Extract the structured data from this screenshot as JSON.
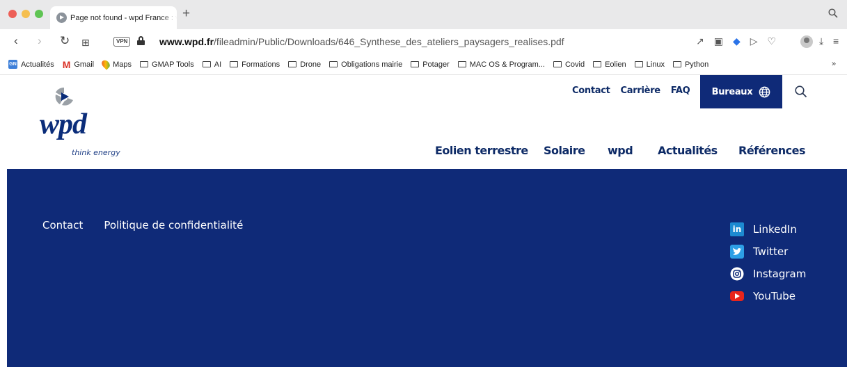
{
  "browser": {
    "tab_title": "Page not found - wpd France : v",
    "url_domain": "www.wpd.fr",
    "url_path": "/fileadmin/Public/Downloads/646_Synthese_des_ateliers_paysagers_realises.pdf",
    "vpn_label": "VPN",
    "bookmarks": [
      {
        "label": "Actualités",
        "icon": "google-news-icon"
      },
      {
        "label": "Gmail",
        "icon": "gmail-icon"
      },
      {
        "label": "Maps",
        "icon": "maps-icon"
      },
      {
        "label": "GMAP Tools",
        "icon": "folder-icon"
      },
      {
        "label": "AI",
        "icon": "folder-icon"
      },
      {
        "label": "Formations",
        "icon": "folder-icon"
      },
      {
        "label": "Drone",
        "icon": "folder-icon"
      },
      {
        "label": "Obligations mairie",
        "icon": "folder-icon"
      },
      {
        "label": "Potager",
        "icon": "folder-icon"
      },
      {
        "label": "MAC OS & Program...",
        "icon": "folder-icon"
      },
      {
        "label": "Covid",
        "icon": "folder-icon"
      },
      {
        "label": "Eolien",
        "icon": "folder-icon"
      },
      {
        "label": "Linux",
        "icon": "folder-icon"
      },
      {
        "label": "Python",
        "icon": "folder-icon"
      }
    ]
  },
  "site": {
    "logo": {
      "word": "wpd",
      "tagline": "think energy"
    },
    "top_nav": {
      "contact": "Contact",
      "careers": "Carrière",
      "faq": "FAQ",
      "offices": "Bureaux"
    },
    "main_nav": [
      "Eolien terrestre",
      "Solaire",
      "wpd",
      "Actualités",
      "Références"
    ],
    "footer": {
      "links": [
        "Contact",
        "Politique de confidentialité"
      ],
      "socials": [
        {
          "label": "LinkedIn",
          "icon": "linkedin-icon"
        },
        {
          "label": "Twitter",
          "icon": "twitter-icon"
        },
        {
          "label": "Instagram",
          "icon": "instagram-icon"
        },
        {
          "label": "YouTube",
          "icon": "youtube-icon"
        }
      ]
    },
    "colors": {
      "brand_navy": "#0f2a78",
      "nav_text": "#0d2a66"
    }
  }
}
